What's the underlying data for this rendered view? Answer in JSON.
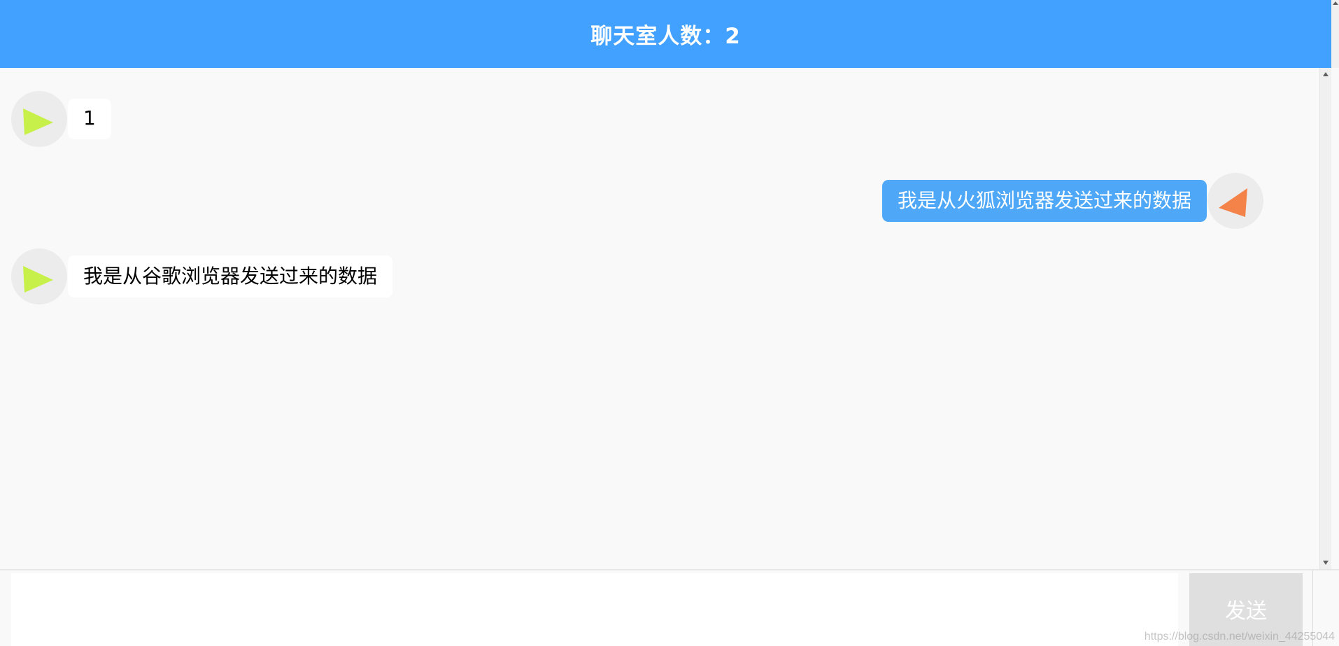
{
  "header": {
    "title": "聊天室人数：2"
  },
  "messages": [
    {
      "side": "left",
      "text": "1",
      "avatar_color": "#c8f04a",
      "avatar_icon": "play-triangle-icon"
    },
    {
      "side": "right",
      "text": "我是从火狐浏览器发送过来的数据",
      "avatar_color": "#f4834a",
      "avatar_icon": "triangle-left-icon"
    },
    {
      "side": "left",
      "text": "我是从谷歌浏览器发送过来的数据",
      "avatar_color": "#c8f04a",
      "avatar_icon": "play-triangle-icon"
    }
  ],
  "composer": {
    "input_value": "",
    "send_label": "发送"
  },
  "watermark": "https://blog.csdn.net/weixin_44255044",
  "colors": {
    "header_bg": "#42a0ff",
    "self_bubble": "#4fa8f7",
    "other_bubble": "#ffffff",
    "send_button_bg": "#dfdfdf"
  }
}
